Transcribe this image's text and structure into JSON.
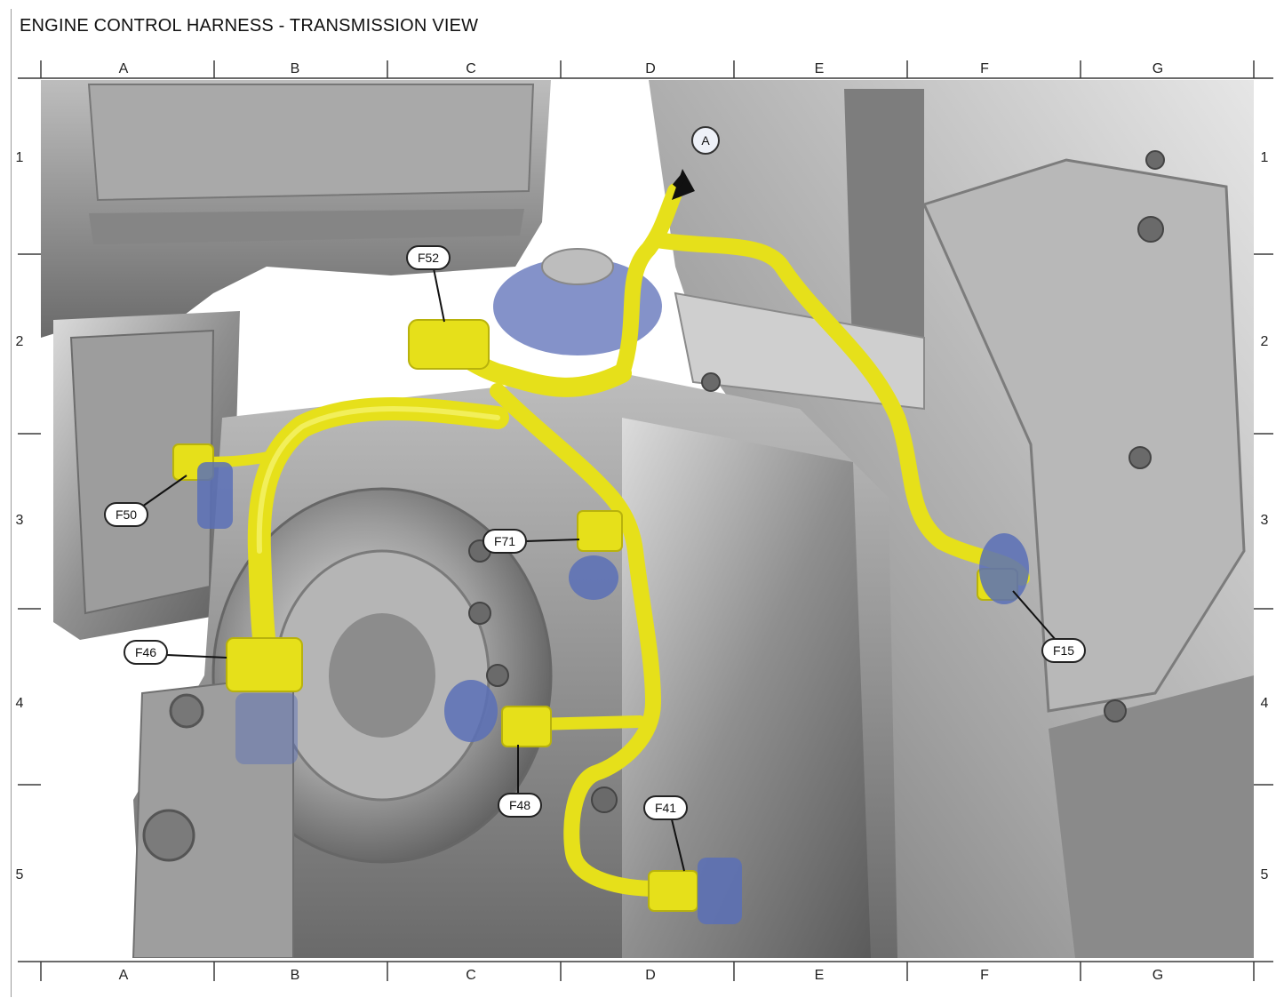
{
  "title": "ENGINE CONTROL HARNESS - TRANSMISSION VIEW",
  "grid": {
    "columns": [
      "A",
      "B",
      "C",
      "D",
      "E",
      "F",
      "G"
    ],
    "rows": [
      "1",
      "2",
      "3",
      "4",
      "5"
    ]
  },
  "callouts": {
    "A": "A",
    "F52": "F52",
    "F50": "F50",
    "F71": "F71",
    "F46": "F46",
    "F15": "F15",
    "F48": "F48",
    "F41": "F41"
  },
  "colors": {
    "harness": "#e6e01a",
    "harness_shade": "#c9c20e",
    "connector_blue": "#5a6fb8",
    "metal_dark": "#5d5d5d",
    "metal_mid": "#9a9a9a",
    "metal_light": "#d8d8d8"
  }
}
